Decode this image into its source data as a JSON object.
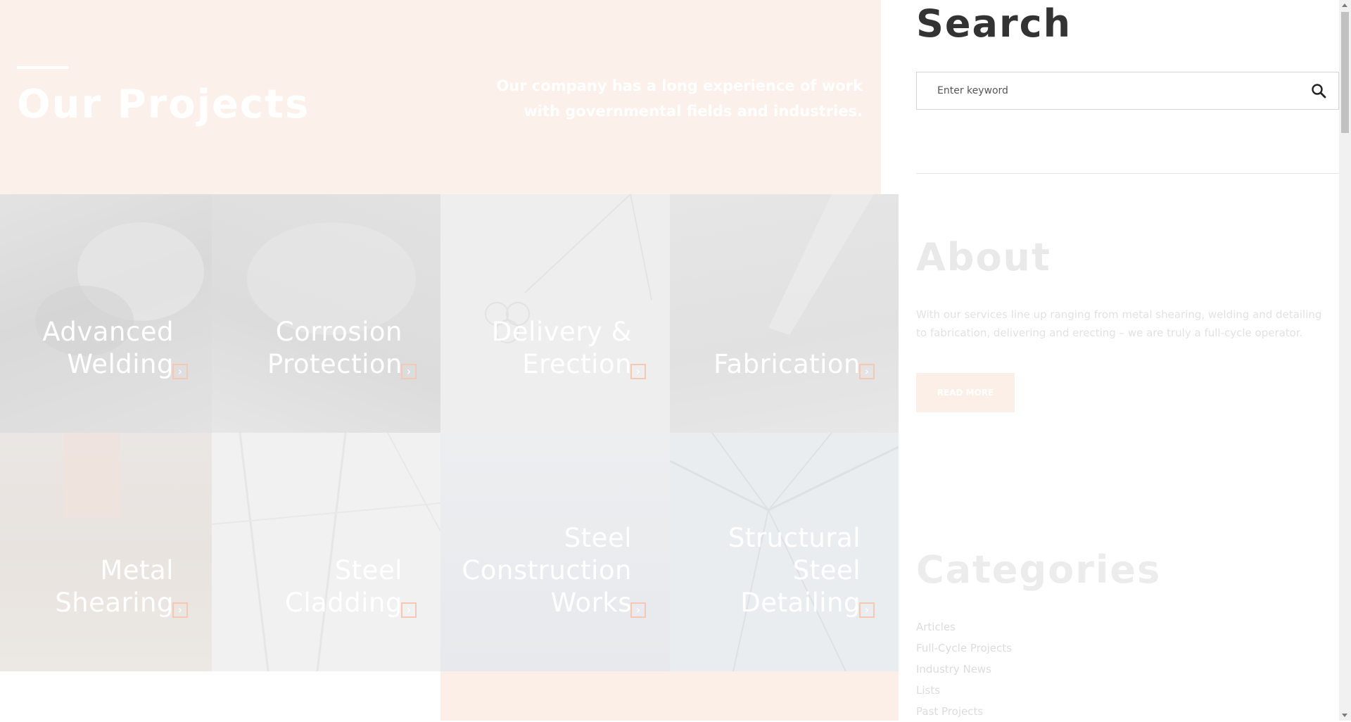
{
  "hero": {
    "title": "Our Projects",
    "description_line1": "Our company has a long experience of work",
    "description_line2": "with governmental fields and industries.",
    "background_color": "#fcf0ea"
  },
  "projects": [
    {
      "line1": "Advanced",
      "line2": "Welding",
      "arrow_icon": "chevron-right-icon"
    },
    {
      "line1": "Corrosion",
      "line2": "Protection",
      "arrow_icon": "chevron-right-icon"
    },
    {
      "line1": "Delivery &",
      "line2": "Erection",
      "arrow_icon": "chevron-right-icon"
    },
    {
      "line1": "Fabrication",
      "arrow_icon": "chevron-right-icon"
    },
    {
      "line1": "Metal",
      "line2": "Shearing",
      "arrow_icon": "chevron-right-icon"
    },
    {
      "line1": "Steel",
      "line2": "Cladding",
      "arrow_icon": "chevron-right-icon"
    },
    {
      "line1": "Steel",
      "line2": "Construction",
      "line3": "Works",
      "arrow_icon": "chevron-right-icon"
    },
    {
      "line1": "Structural",
      "line2": "Steel",
      "line3": "Detailing",
      "arrow_icon": "chevron-right-icon"
    }
  ],
  "sidebar": {
    "search": {
      "title": "Search",
      "placeholder": "Enter keyword",
      "button_icon": "search-icon"
    },
    "about": {
      "title": "About",
      "text": "With our services line up ranging from metal shearing, welding and detailing to fabrication, delivering and erecting – we are truly a full-cycle operator.",
      "button_label": "READ MORE"
    },
    "categories": {
      "title": "Categories",
      "items": [
        "Articles",
        "Full-Cycle Projects",
        "Industry News",
        "Lists",
        "Past Projects"
      ]
    }
  },
  "colors": {
    "accent_peach": "#fcefe8",
    "arrow_border": "#f6c8b3",
    "heading_dark": "#333333"
  }
}
